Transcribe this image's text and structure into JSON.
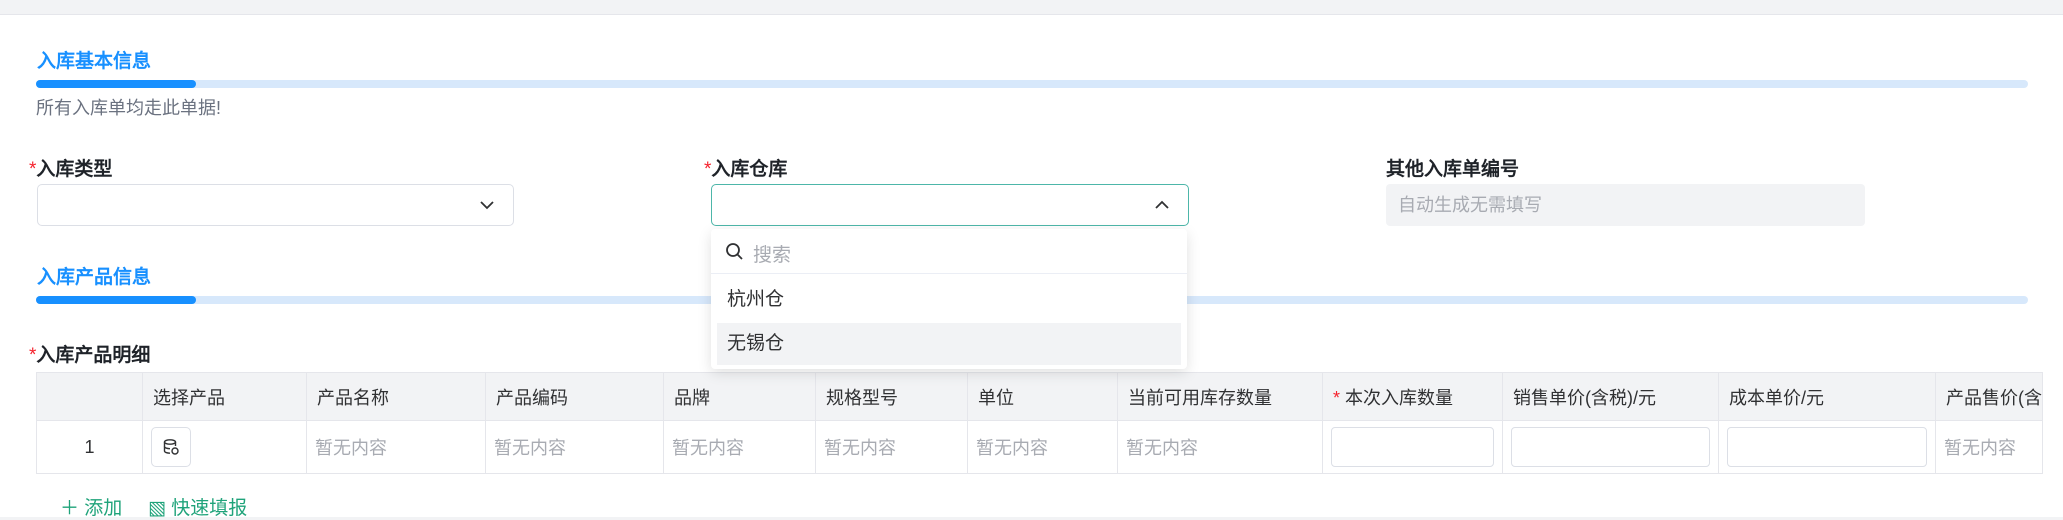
{
  "section_basic": {
    "title": "入库基本信息",
    "hint": "所有入库单均走此单据!"
  },
  "form": {
    "required_mark": "*",
    "type_label": "入库类型",
    "warehouse_label": "入库仓库",
    "number_label": "其他入库单编号",
    "number_placeholder": "自动生成无需填写"
  },
  "dropdown": {
    "search_placeholder": "搜索",
    "options": [
      "杭州仓",
      "无锡仓"
    ],
    "highlighted": "无锡仓"
  },
  "section_products": {
    "title": "入库产品信息",
    "detail_label": "入库产品明细"
  },
  "table": {
    "columns": [
      "选择产品",
      "产品名称",
      "产品编码",
      "品牌",
      "规格型号",
      "单位",
      "当前可用库存数量",
      "本次入库数量",
      "销售单价(含税)/元",
      "成本单价/元",
      "产品售价(含"
    ],
    "row": {
      "index": "1",
      "empty_text": "暂无内容"
    }
  },
  "actions": {
    "add": "添加",
    "quick_fill": "快速填报"
  },
  "colors": {
    "accent": "#1890ff",
    "required": "#f5222d",
    "link": "#1fa37a"
  }
}
